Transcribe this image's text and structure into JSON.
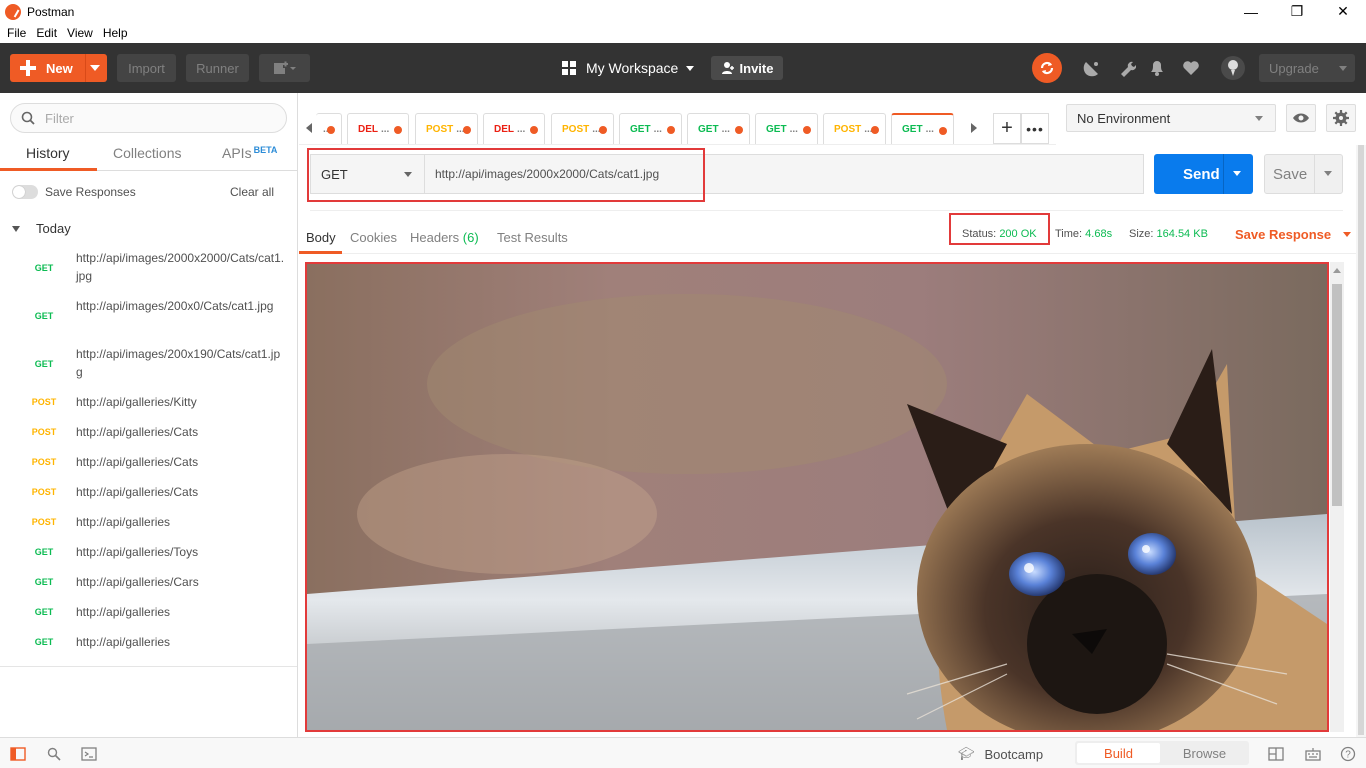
{
  "window": {
    "title": "Postman",
    "controls": [
      "—",
      "❐",
      "✕"
    ]
  },
  "menu": [
    "File",
    "Edit",
    "View",
    "Help"
  ],
  "header": {
    "new_label": "New",
    "import_label": "Import",
    "runner_label": "Runner",
    "workspace_label": "My Workspace",
    "invite_label": "Invite",
    "upgrade_label": "Upgrade",
    "icons": [
      "sync-icon",
      "satellite-icon",
      "wrench-icon",
      "bell-icon",
      "heart-icon",
      "balloon-icon"
    ]
  },
  "sidebar": {
    "filter_placeholder": "Filter",
    "tabs": [
      "History",
      "Collections",
      "APIs"
    ],
    "beta_label": "BETA",
    "save_responses_label": "Save Responses",
    "clear_all_label": "Clear all",
    "group_label": "Today",
    "history": [
      {
        "method": "GET",
        "url": "http://api/images/2000x2000/Cats/cat1.jpg"
      },
      {
        "method": "GET",
        "url": "http://api/images/200x0/Cats/cat1.jpg"
      },
      {
        "method": "GET",
        "url": "http://api/images/200x190/Cats/cat1.jpg"
      },
      {
        "method": "POST",
        "url": "http://api/galleries/Kitty"
      },
      {
        "method": "POST",
        "url": "http://api/galleries/Cats"
      },
      {
        "method": "POST",
        "url": "http://api/galleries/Cats"
      },
      {
        "method": "POST",
        "url": "http://api/galleries/Cats"
      },
      {
        "method": "POST",
        "url": "http://api/galleries"
      },
      {
        "method": "GET",
        "url": "http://api/galleries/Toys"
      },
      {
        "method": "GET",
        "url": "http://api/galleries/Cars"
      },
      {
        "method": "GET",
        "url": "http://api/galleries"
      },
      {
        "method": "GET",
        "url": "http://api/galleries"
      }
    ]
  },
  "request_tabs": [
    {
      "method": "DEL"
    },
    {
      "method": "POST"
    },
    {
      "method": "DEL"
    },
    {
      "method": "POST"
    },
    {
      "method": "GET"
    },
    {
      "method": "GET"
    },
    {
      "method": "GET"
    },
    {
      "method": "POST"
    },
    {
      "method": "GET"
    }
  ],
  "tab_ellipsis": "...",
  "environment": {
    "selected": "No Environment"
  },
  "request": {
    "method": "GET",
    "url": "http://api/images/2000x2000/Cats/cat1.jpg",
    "send_label": "Send",
    "save_label": "Save"
  },
  "response": {
    "tabs": [
      "Body",
      "Cookies",
      "Headers",
      "Test Results"
    ],
    "headers_count": "(6)",
    "status_label": "Status:",
    "status_value": "200 OK",
    "time_label": "Time:",
    "time_value": "4.68s",
    "size_label": "Size:",
    "size_value": "164.54 KB",
    "save_response_label": "Save Response"
  },
  "footer": {
    "bootcamp_label": "Bootcamp",
    "build_label": "Build",
    "browse_label": "Browse"
  },
  "colors": {
    "brand": "#ef5b25",
    "send_blue": "#097bed",
    "get_green": "#0cbb52",
    "post_yellow": "#ffb400",
    "del_red": "#eb2013",
    "highlight_red": "#e23a3a"
  }
}
